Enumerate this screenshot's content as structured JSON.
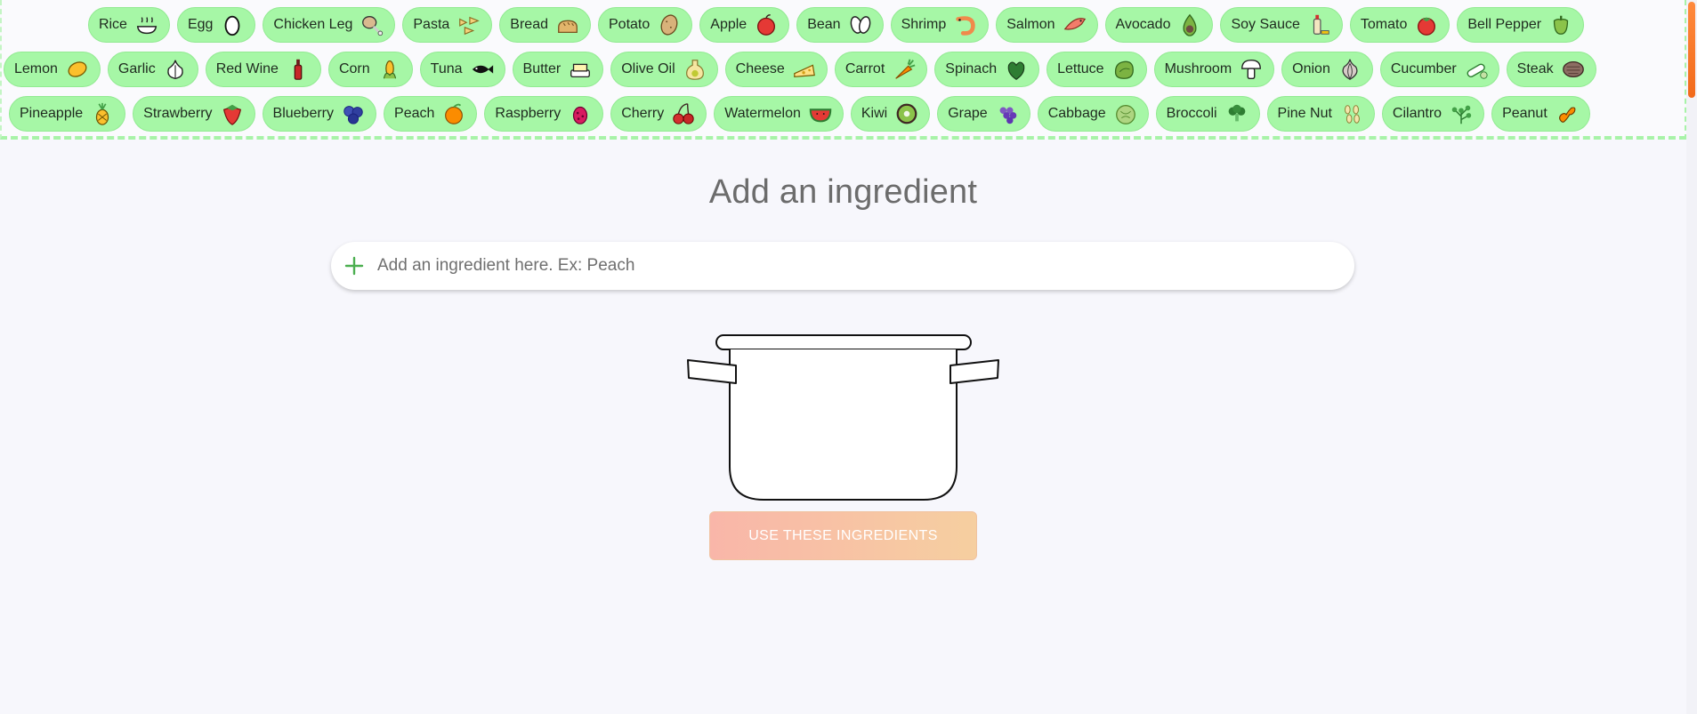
{
  "ingredients": {
    "row0": [
      {
        "label": "Rice",
        "icon": "rice-bowl-icon"
      },
      {
        "label": "Egg",
        "icon": "egg-icon"
      },
      {
        "label": "Chicken Leg",
        "icon": "chicken-leg-icon"
      },
      {
        "label": "Pasta",
        "icon": "pasta-icon"
      },
      {
        "label": "Bread",
        "icon": "bread-icon"
      },
      {
        "label": "Potato",
        "icon": "potato-icon"
      },
      {
        "label": "Apple",
        "icon": "apple-icon"
      },
      {
        "label": "Bean",
        "icon": "bean-icon"
      },
      {
        "label": "Shrimp",
        "icon": "shrimp-icon"
      },
      {
        "label": "Salmon",
        "icon": "salmon-icon"
      },
      {
        "label": "Avocado",
        "icon": "avocado-icon"
      },
      {
        "label": "Soy Sauce",
        "icon": "soy-sauce-icon"
      },
      {
        "label": "Tomato",
        "icon": "tomato-icon"
      },
      {
        "label": "Bell Pepper",
        "icon": "bell-pepper-icon"
      }
    ],
    "row1": [
      {
        "label": "Lemon",
        "icon": "lemon-icon"
      },
      {
        "label": "Garlic",
        "icon": "garlic-icon"
      },
      {
        "label": "Red Wine",
        "icon": "red-wine-icon"
      },
      {
        "label": "Corn",
        "icon": "corn-icon"
      },
      {
        "label": "Tuna",
        "icon": "tuna-icon"
      },
      {
        "label": "Butter",
        "icon": "butter-icon"
      },
      {
        "label": "Olive Oil",
        "icon": "olive-oil-icon"
      },
      {
        "label": "Cheese",
        "icon": "cheese-icon"
      },
      {
        "label": "Carrot",
        "icon": "carrot-icon"
      },
      {
        "label": "Spinach",
        "icon": "spinach-icon"
      },
      {
        "label": "Lettuce",
        "icon": "lettuce-icon"
      },
      {
        "label": "Mushroom",
        "icon": "mushroom-icon"
      },
      {
        "label": "Onion",
        "icon": "onion-icon"
      },
      {
        "label": "Cucumber",
        "icon": "cucumber-icon"
      },
      {
        "label": "Steak",
        "icon": "steak-icon"
      }
    ],
    "row2": [
      {
        "label": "Pineapple",
        "icon": "pineapple-icon"
      },
      {
        "label": "Strawberry",
        "icon": "strawberry-icon"
      },
      {
        "label": "Blueberry",
        "icon": "blueberry-icon"
      },
      {
        "label": "Peach",
        "icon": "peach-icon"
      },
      {
        "label": "Raspberry",
        "icon": "raspberry-icon"
      },
      {
        "label": "Cherry",
        "icon": "cherry-icon"
      },
      {
        "label": "Watermelon",
        "icon": "watermelon-icon"
      },
      {
        "label": "Kiwi",
        "icon": "kiwi-icon"
      },
      {
        "label": "Grape",
        "icon": "grape-icon"
      },
      {
        "label": "Cabbage",
        "icon": "cabbage-icon"
      },
      {
        "label": "Broccoli",
        "icon": "broccoli-icon"
      },
      {
        "label": "Pine Nut",
        "icon": "pine-nut-icon"
      },
      {
        "label": "Cilantro",
        "icon": "cilantro-icon"
      },
      {
        "label": "Peanut",
        "icon": "peanut-icon"
      }
    ]
  },
  "main": {
    "title": "Add an ingredient",
    "search_placeholder": "Add an ingredient here. Ex: Peach",
    "plus_icon": "plus-icon",
    "pot_icon": "cooking-pot-icon",
    "button_label": "USE THESE INGREDIENTS"
  },
  "colors": {
    "chip_bg": "#a6f7a6",
    "accent_plus": "#4caf50",
    "button_gradient_start": "#f9b6a9",
    "button_gradient_end": "#f6cfa0",
    "scroll_thumb": "#f26a1b"
  }
}
